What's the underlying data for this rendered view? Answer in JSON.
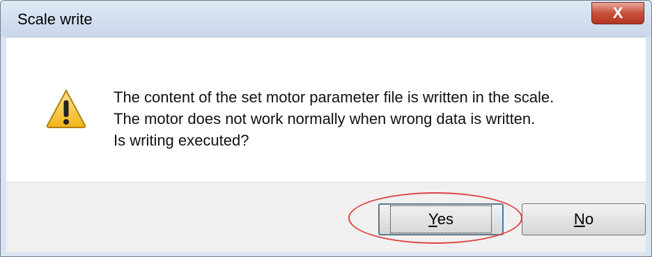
{
  "window": {
    "title": "Scale write",
    "close_label": "X"
  },
  "message": {
    "lines": [
      "The content of the set motor parameter file is written in the scale.",
      "The motor does not work normally when wrong data is written.",
      "Is writing executed?"
    ]
  },
  "buttons": {
    "yes_mnemonic": "Y",
    "yes_rest": "es",
    "no_mnemonic": "N",
    "no_rest": "o"
  },
  "colors": {
    "highlight": "#e04040",
    "warning_fill": "#f7c82b"
  },
  "icons": {
    "warning": "warning-icon",
    "close": "close-icon"
  }
}
